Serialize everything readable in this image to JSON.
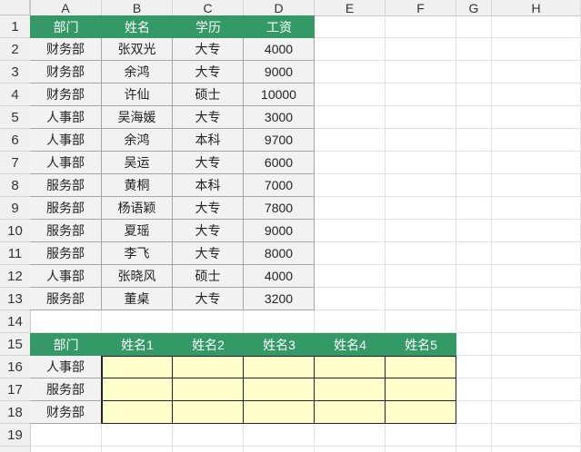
{
  "columns": [
    "A",
    "B",
    "C",
    "D",
    "E",
    "F",
    "G",
    "H"
  ],
  "rows": [
    "1",
    "2",
    "3",
    "4",
    "5",
    "6",
    "7",
    "8",
    "9",
    "10",
    "11",
    "12",
    "13",
    "14",
    "15",
    "16",
    "17",
    "18",
    "19"
  ],
  "table1": {
    "headers": [
      "部门",
      "姓名",
      "学历",
      "工资"
    ],
    "rows": [
      [
        "财务部",
        "张双光",
        "大专",
        "4000"
      ],
      [
        "财务部",
        "余鸿",
        "大专",
        "9000"
      ],
      [
        "财务部",
        "许仙",
        "硕士",
        "10000"
      ],
      [
        "人事部",
        "吴海媛",
        "大专",
        "3000"
      ],
      [
        "人事部",
        "余鸿",
        "本科",
        "9700"
      ],
      [
        "人事部",
        "吴运",
        "大专",
        "6000"
      ],
      [
        "服务部",
        "黄桐",
        "本科",
        "7000"
      ],
      [
        "服务部",
        "杨语颖",
        "大专",
        "7800"
      ],
      [
        "服务部",
        "夏瑶",
        "大专",
        "9000"
      ],
      [
        "服务部",
        "李飞",
        "大专",
        "8000"
      ],
      [
        "人事部",
        "张晓风",
        "硕士",
        "4000"
      ],
      [
        "服务部",
        "董桌",
        "大专",
        "3200"
      ]
    ]
  },
  "table2": {
    "headers": [
      "部门",
      "姓名1",
      "姓名2",
      "姓名3",
      "姓名4",
      "姓名5"
    ],
    "departments": [
      "人事部",
      "服务部",
      "财务部"
    ]
  },
  "colors": {
    "header_green": "#339966",
    "input_yellow": "#ffffcc",
    "data_gray": "#f2f2f2"
  }
}
